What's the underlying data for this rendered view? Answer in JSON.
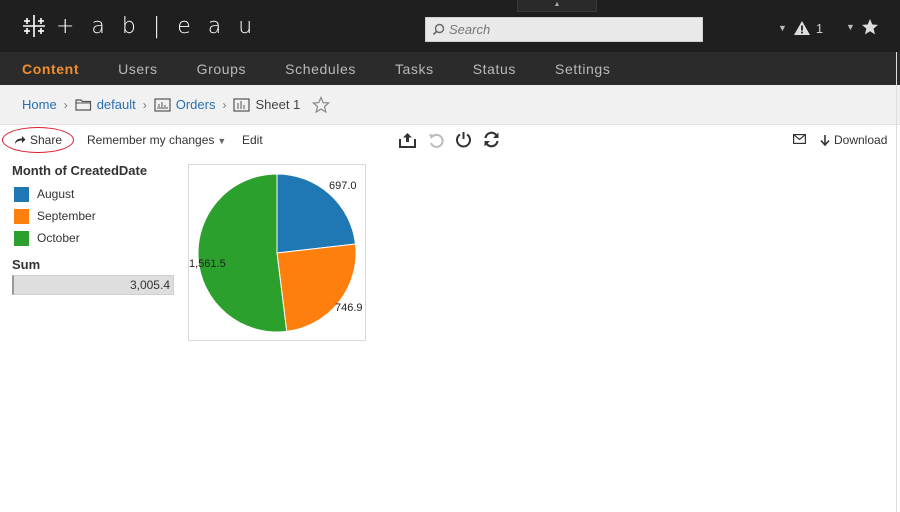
{
  "app": {
    "logo_text": "+ a b | e a u",
    "search_placeholder": "Search",
    "alert_count": "1"
  },
  "nav": {
    "items": [
      "Content",
      "Users",
      "Groups",
      "Schedules",
      "Tasks",
      "Status",
      "Settings"
    ],
    "active": "Content"
  },
  "breadcrumb": {
    "home": "Home",
    "project": "default",
    "workbook": "Orders",
    "sheet": "Sheet 1"
  },
  "toolbar": {
    "share_label": "Share",
    "remember_label": "Remember my changes",
    "edit_label": "Edit",
    "download_label": "Download"
  },
  "legend": {
    "title": "Month of CreatedDate",
    "items": [
      {
        "label": "August",
        "color": "#1f77b4"
      },
      {
        "label": "September",
        "color": "#ff7f0e"
      },
      {
        "label": "October",
        "color": "#2ca02c"
      }
    ],
    "sum_title": "Sum",
    "sum_value": "3,005.4"
  },
  "colors": {
    "accent": "#f28e2b",
    "link": "#2a6fb0",
    "highlight_circle": "#d6202a"
  },
  "chart_data": {
    "type": "pie",
    "categories": [
      "August",
      "September",
      "October"
    ],
    "values": [
      697.0,
      746.9,
      1561.5
    ],
    "labels": [
      "697.0",
      "746.9",
      "1,561.5"
    ],
    "colors": [
      "#1f77b4",
      "#ff7f0e",
      "#2ca02c"
    ],
    "total": 3005.4
  }
}
